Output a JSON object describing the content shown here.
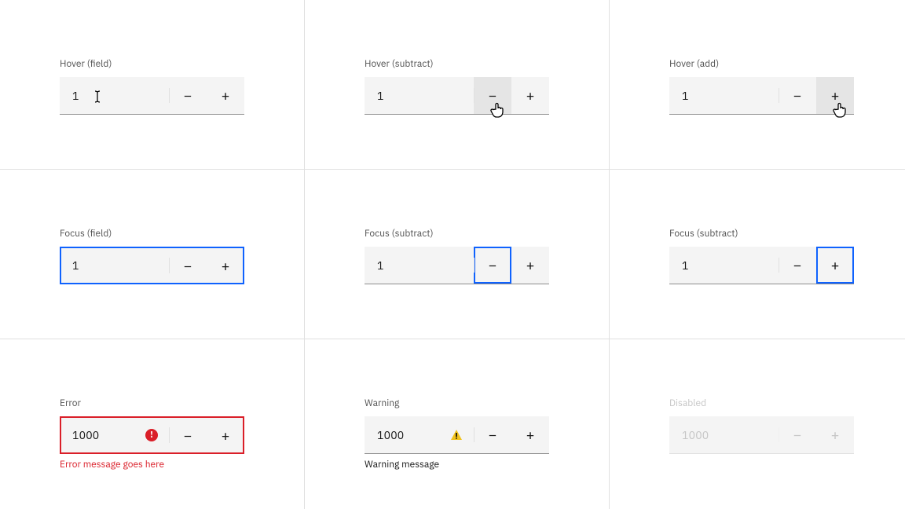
{
  "states": [
    {
      "label": "Hover (field)",
      "value": "1",
      "helper": ""
    },
    {
      "label": "Hover (subtract)",
      "value": "1",
      "helper": ""
    },
    {
      "label": "Hover (add)",
      "value": "1",
      "helper": ""
    },
    {
      "label": "Focus (field)",
      "value": "1",
      "helper": ""
    },
    {
      "label": "Focus (subtract)",
      "value": "1",
      "helper": ""
    },
    {
      "label": "Focus (subtract)",
      "value": "1",
      "helper": ""
    },
    {
      "label": "Error",
      "value": "1000",
      "helper": "Error message goes here"
    },
    {
      "label": "Warning",
      "value": "1000",
      "helper": "Warning message"
    },
    {
      "label": "Disabled",
      "value": "1000",
      "helper": ""
    }
  ],
  "glyphs": {
    "minus": "−",
    "plus": "+"
  }
}
